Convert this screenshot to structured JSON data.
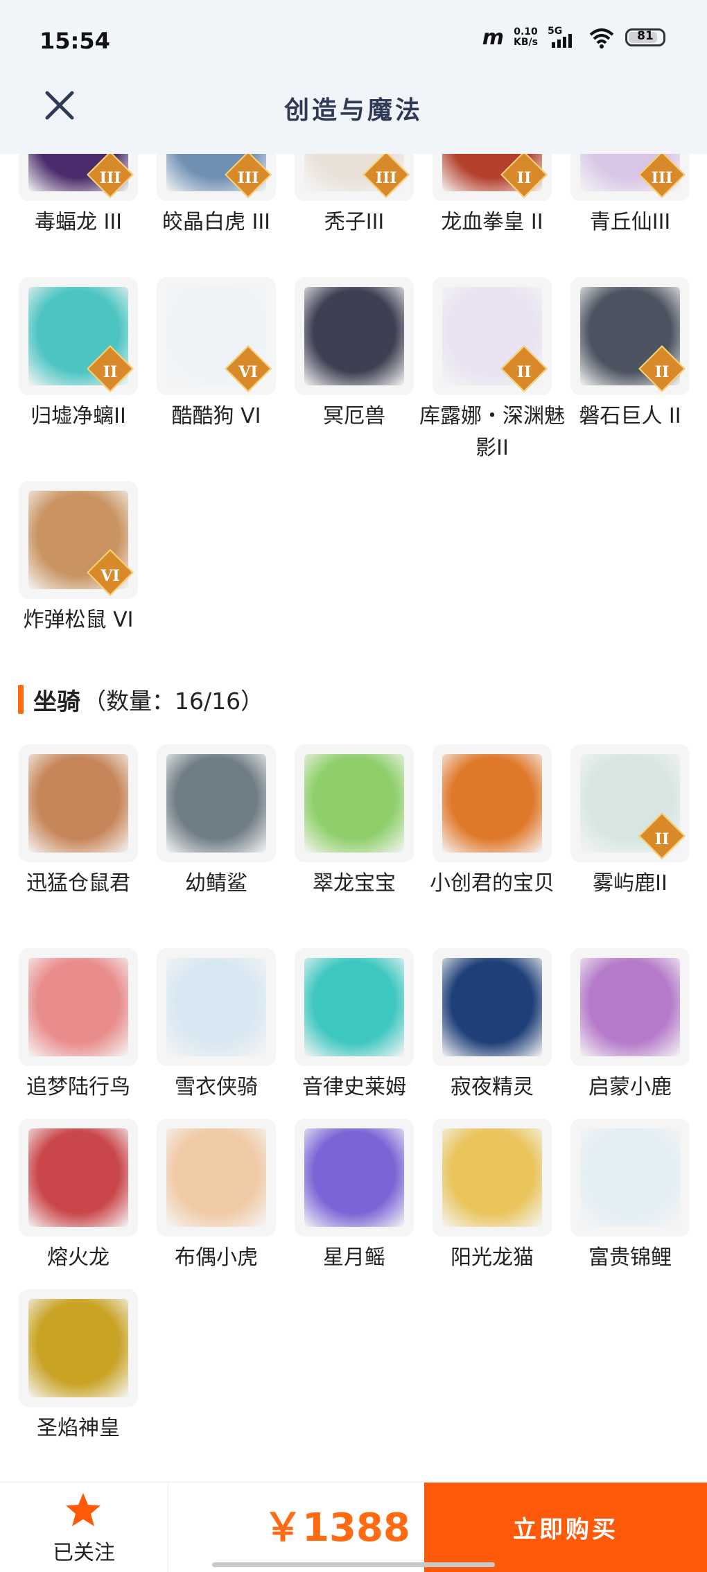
{
  "status_bar": {
    "time": "15:54",
    "speed_value": "0.10",
    "speed_unit": "KB/s",
    "network": "5G",
    "battery": "81"
  },
  "header": {
    "title": "创造与魔法"
  },
  "pets_partial": [
    {
      "name": "毒蝠龙 III",
      "badge": "III",
      "color": "#4a2b6b"
    },
    {
      "name": "皎晶白虎 III",
      "badge": "III",
      "color": "#6f8fb3"
    },
    {
      "name": "秃子III",
      "badge": "III",
      "color": "#e9e0d8"
    },
    {
      "name": "龙血拳皇 II",
      "badge": "II",
      "color": "#b4402c"
    },
    {
      "name": "青丘仙III",
      "badge": "III",
      "color": "#d9c6e6"
    },
    {
      "name": "归墟净螭II",
      "badge": "II",
      "color": "#4cc5c2"
    },
    {
      "name": "酷酷狗 VI",
      "badge": "VI",
      "color": "#eef3f8"
    },
    {
      "name": "冥厄兽",
      "badge": "",
      "color": "#3d3f52"
    },
    {
      "name": "库露娜・深渊魅影II",
      "badge": "II",
      "color": "#e8e2f2"
    },
    {
      "name": "磐石巨人 II",
      "badge": "II",
      "color": "#4b5360"
    },
    {
      "name": "炸弹松鼠 VI",
      "badge": "VI",
      "color": "#c99462"
    }
  ],
  "mounts_section": {
    "title": "坐骑",
    "count": "（数量：16/16）"
  },
  "mounts": [
    {
      "name": "迅猛仓鼠君",
      "badge": "",
      "color": "#c7865a"
    },
    {
      "name": "幼鲭鲨",
      "badge": "",
      "color": "#6f7e86"
    },
    {
      "name": "翠龙宝宝",
      "badge": "",
      "color": "#8fcf6a"
    },
    {
      "name": "小创君的宝贝",
      "badge": "",
      "color": "#e0782a"
    },
    {
      "name": "雾屿鹿II",
      "badge": "II",
      "color": "#d7e6e2"
    },
    {
      "name": "追梦陆行鸟",
      "badge": "",
      "color": "#e98c8c"
    },
    {
      "name": "雪衣侠骑",
      "badge": "",
      "color": "#d8e8f2"
    },
    {
      "name": "音律史莱姆",
      "badge": "",
      "color": "#3ec7c0"
    },
    {
      "name": "寂夜精灵",
      "badge": "",
      "color": "#1f3f78"
    },
    {
      "name": "启蒙小鹿",
      "badge": "",
      "color": "#b57ac9"
    },
    {
      "name": "熔火龙",
      "badge": "",
      "color": "#c9474a"
    },
    {
      "name": "布偶小虎",
      "badge": "",
      "color": "#f0c9a5"
    },
    {
      "name": "星月鳐",
      "badge": "",
      "color": "#7a64d6"
    },
    {
      "name": "阳光龙猫",
      "badge": "",
      "color": "#e9c45a"
    },
    {
      "name": "富贵锦鲤",
      "badge": "",
      "color": "#e3eef5"
    },
    {
      "name": "圣焰神皇",
      "badge": "",
      "color": "#c9a324"
    }
  ],
  "bottom_bar": {
    "follow_label": "已关注",
    "price": "￥1388",
    "buy_label": "立即购买"
  }
}
